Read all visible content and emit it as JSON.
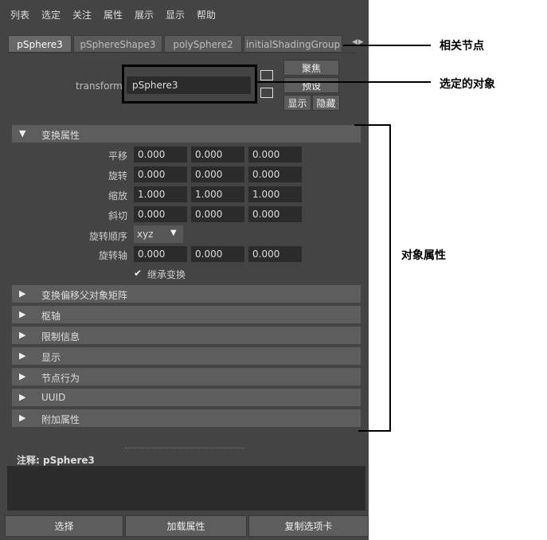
{
  "menu": [
    "列表",
    "选定",
    "关注",
    "属性",
    "展示",
    "显示",
    "帮助"
  ],
  "tabs": [
    "pSphere3",
    "pSphereShape3",
    "polySphere2",
    "initialShadingGroup"
  ],
  "tab_scroll_arrows": "◀ ▶",
  "transform": {
    "label": "transform",
    "value": "pSphere3"
  },
  "side_buttons": {
    "focus": "聚焦",
    "preset": "预设",
    "show": "显示",
    "hide": "隐藏"
  },
  "sections": {
    "transform_attrs": "变换属性",
    "collapsed": [
      "变换偏移父对象矩阵",
      "枢轴",
      "限制信息",
      "显示",
      "节点行为",
      "UUID",
      "附加属性"
    ]
  },
  "attrs": {
    "translate": {
      "label": "平移",
      "values": [
        "0.000",
        "0.000",
        "0.000"
      ]
    },
    "rotate": {
      "label": "旋转",
      "values": [
        "0.000",
        "0.000",
        "0.000"
      ]
    },
    "scale": {
      "label": "缩放",
      "values": [
        "1.000",
        "1.000",
        "1.000"
      ]
    },
    "shear": {
      "label": "斜切",
      "values": [
        "0.000",
        "0.000",
        "0.000"
      ]
    },
    "rotate_order": {
      "label": "旋转顺序",
      "value": "xyz"
    },
    "rotate_axis": {
      "label": "旋转轴",
      "values": [
        "0.000",
        "0.000",
        "0.000"
      ]
    },
    "inherit": {
      "label": "继承变换",
      "checked": true
    }
  },
  "notes": {
    "label": "注释:  pSphere3"
  },
  "bottom_buttons": [
    "选择",
    "加载属性",
    "复制选项卡"
  ],
  "annotations": {
    "related_nodes": "相关节点",
    "selected_object": "选定的对象",
    "object_attrs": "对象属性"
  }
}
